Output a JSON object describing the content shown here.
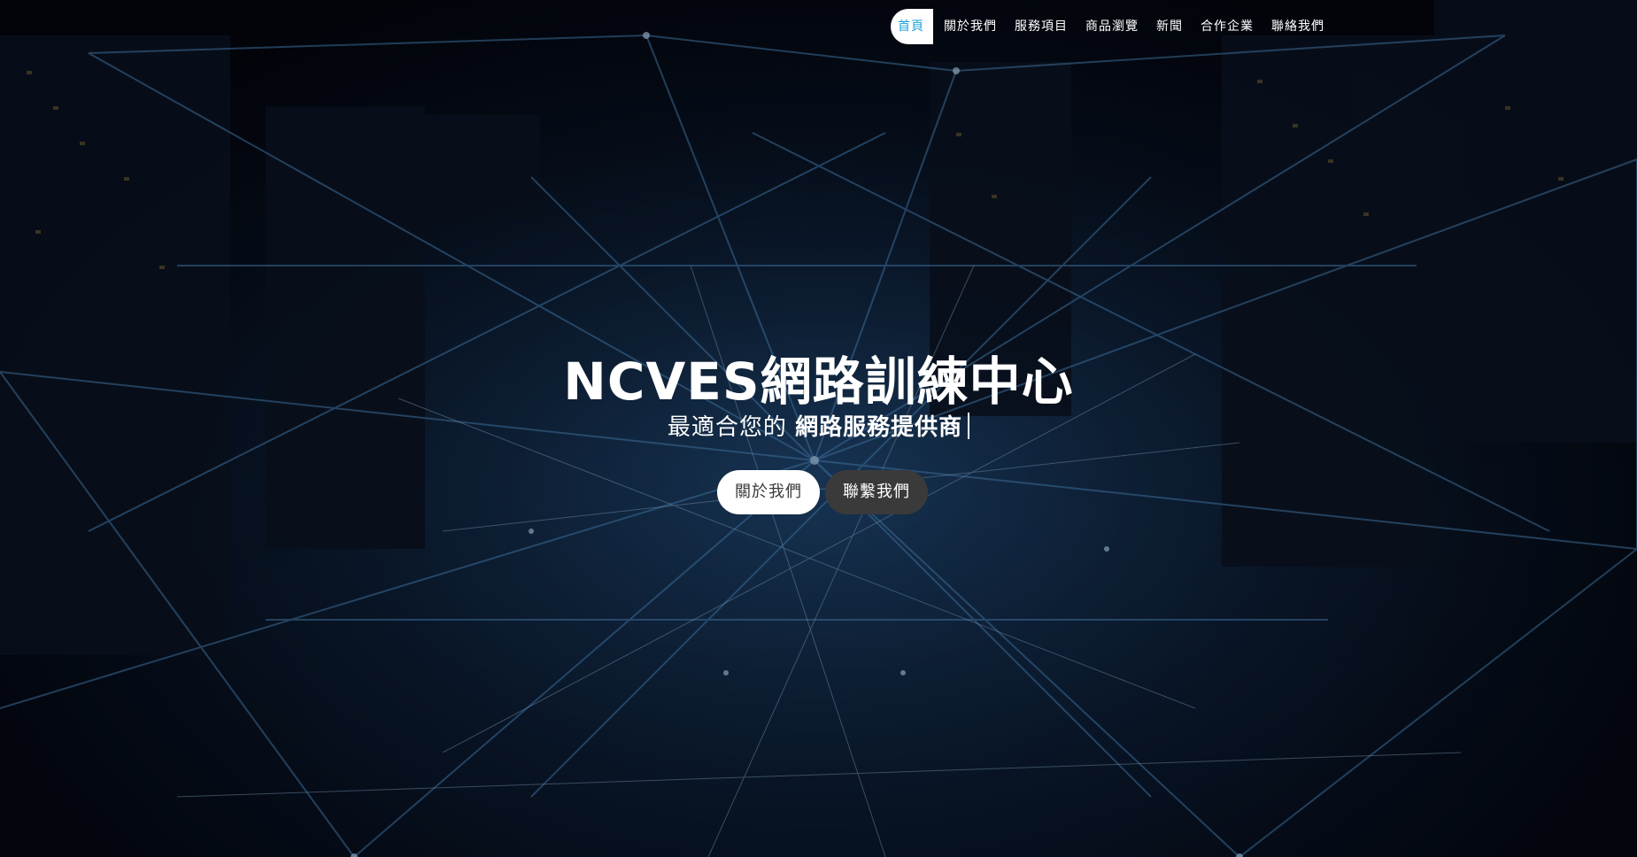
{
  "nav": {
    "items": [
      {
        "label": "首頁",
        "active": true
      },
      {
        "label": "關於我們",
        "active": false
      },
      {
        "label": "服務項目",
        "active": false
      },
      {
        "label": "商品瀏覽",
        "active": false
      },
      {
        "label": "新聞",
        "active": false
      },
      {
        "label": "合作企業",
        "active": false
      },
      {
        "label": "聯絡我們",
        "active": false
      }
    ]
  },
  "hero": {
    "title": "NCVES網路訓練中心",
    "subtitle_prefix": "最適合您的 ",
    "subtitle_highlight": "網路服務提供商",
    "buttons": {
      "about": "關於我們",
      "contact": "聯繫我們"
    }
  },
  "colors": {
    "accent": "#1aa3d9",
    "button_dark": "#3a3a3a",
    "background": "#05070d"
  }
}
